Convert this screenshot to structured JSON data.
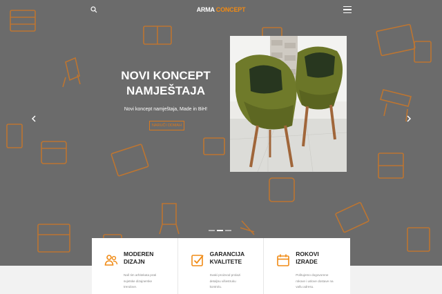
{
  "brand": {
    "part1": "ARMA",
    "part2": "CONCEPT"
  },
  "header": {
    "search_icon": "search-icon",
    "menu_icon": "hamburger-menu-icon"
  },
  "hero": {
    "title_line1": "NOVI KONCEPT",
    "title_line2": "NAMJEŠTAJA",
    "subtitle": "Novi koncept namještaja, Made in BiH!",
    "cta_label": "NARUČI ODMAH",
    "image_alt": "two-green-velvet-chairs"
  },
  "slider": {
    "slides": 3,
    "active_index": 1
  },
  "features": [
    {
      "icon": "users-icon",
      "title_line1": "MODEREN",
      "title_line2": "DIZAJN",
      "text": [
        "Naš tim arhitekata prati",
        "svjetske dizajnerske",
        "trendove."
      ]
    },
    {
      "icon": "checkbox-icon",
      "title_line1": "GARANCIJA",
      "title_line2": "KVALITETE",
      "text": [
        "Svaki proizvod prolazi",
        "detaljnu višestruku",
        "kontrolu."
      ]
    },
    {
      "icon": "calendar-icon",
      "title_line1": "ROKOVI",
      "title_line2": "IZRADE",
      "text": [
        "Poštujemo dogovorene",
        "rokove i uslove dostave na",
        "vašu adresu."
      ]
    }
  ],
  "colors": {
    "accent": "#f08a14",
    "hero_bg": "#6b6b6b",
    "pattern": "#d9791e"
  }
}
